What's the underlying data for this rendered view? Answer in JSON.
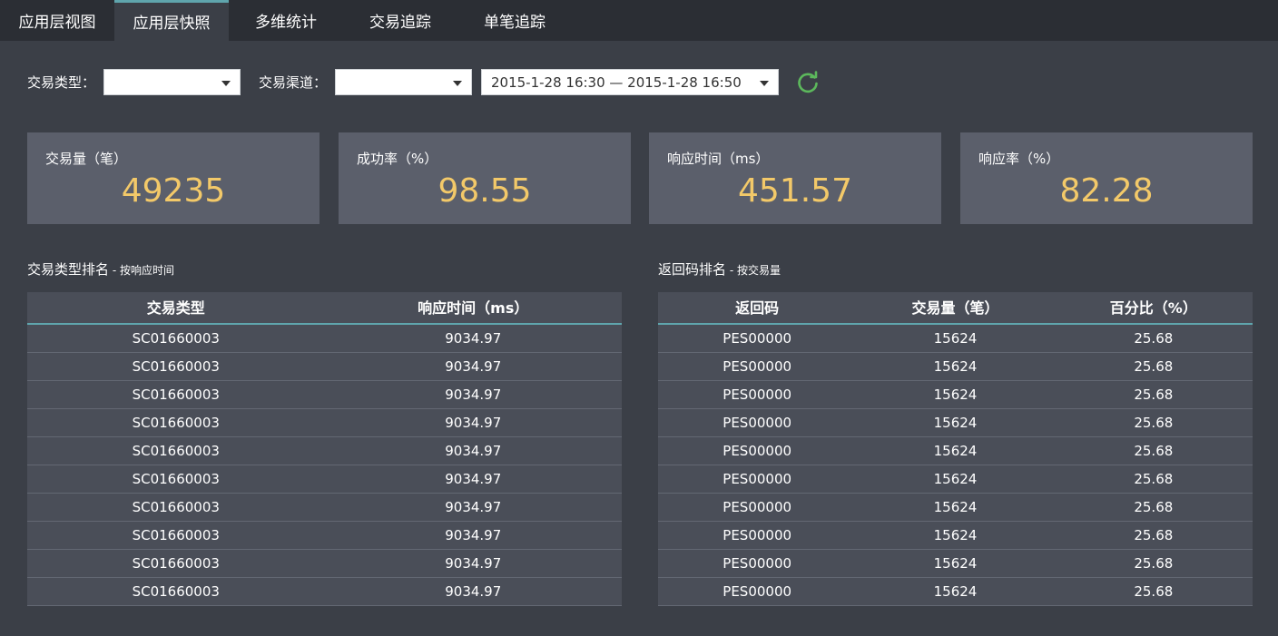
{
  "tabs": [
    {
      "label": "应用层视图"
    },
    {
      "label": "应用层快照"
    },
    {
      "label": "多维统计"
    },
    {
      "label": "交易追踪"
    },
    {
      "label": "单笔追踪"
    }
  ],
  "active_tab": "应用层快照",
  "filters": {
    "type_label": "交易类型：",
    "type_value": "",
    "channel_label": "交易渠道：",
    "channel_value": "",
    "time_range": "2015-1-28 16:30 — 2015-1-28 16:50"
  },
  "kpis": [
    {
      "label": "交易量（笔）",
      "value": "49235"
    },
    {
      "label": "成功率（%）",
      "value": "98.55"
    },
    {
      "label": "响应时间（ms）",
      "value": "451.57"
    },
    {
      "label": "响应率（%）",
      "value": "82.28"
    }
  ],
  "left_table": {
    "title": "交易类型排名",
    "subtitle": " - 按响应时间",
    "headers": [
      "交易类型",
      "响应时间（ms）"
    ],
    "rows": [
      [
        "SC01660003",
        "9034.97"
      ],
      [
        "SC01660003",
        "9034.97"
      ],
      [
        "SC01660003",
        "9034.97"
      ],
      [
        "SC01660003",
        "9034.97"
      ],
      [
        "SC01660003",
        "9034.97"
      ],
      [
        "SC01660003",
        "9034.97"
      ],
      [
        "SC01660003",
        "9034.97"
      ],
      [
        "SC01660003",
        "9034.97"
      ],
      [
        "SC01660003",
        "9034.97"
      ],
      [
        "SC01660003",
        "9034.97"
      ]
    ]
  },
  "right_table": {
    "title": "返回码排名",
    "subtitle": " - 按交易量",
    "headers": [
      "返回码",
      "交易量（笔）",
      "百分比（%）"
    ],
    "rows": [
      [
        "PES00000",
        "15624",
        "25.68"
      ],
      [
        "PES00000",
        "15624",
        "25.68"
      ],
      [
        "PES00000",
        "15624",
        "25.68"
      ],
      [
        "PES00000",
        "15624",
        "25.68"
      ],
      [
        "PES00000",
        "15624",
        "25.68"
      ],
      [
        "PES00000",
        "15624",
        "25.68"
      ],
      [
        "PES00000",
        "15624",
        "25.68"
      ],
      [
        "PES00000",
        "15624",
        "25.68"
      ],
      [
        "PES00000",
        "15624",
        "25.68"
      ],
      [
        "PES00000",
        "15624",
        "25.68"
      ]
    ]
  },
  "colors": {
    "accent": "#5fa5ad",
    "kpi_value": "#f3c969",
    "refresh": "#5cb85c"
  },
  "icons": {
    "refresh": "refresh-icon",
    "dropdown": "chevron-down-icon"
  }
}
